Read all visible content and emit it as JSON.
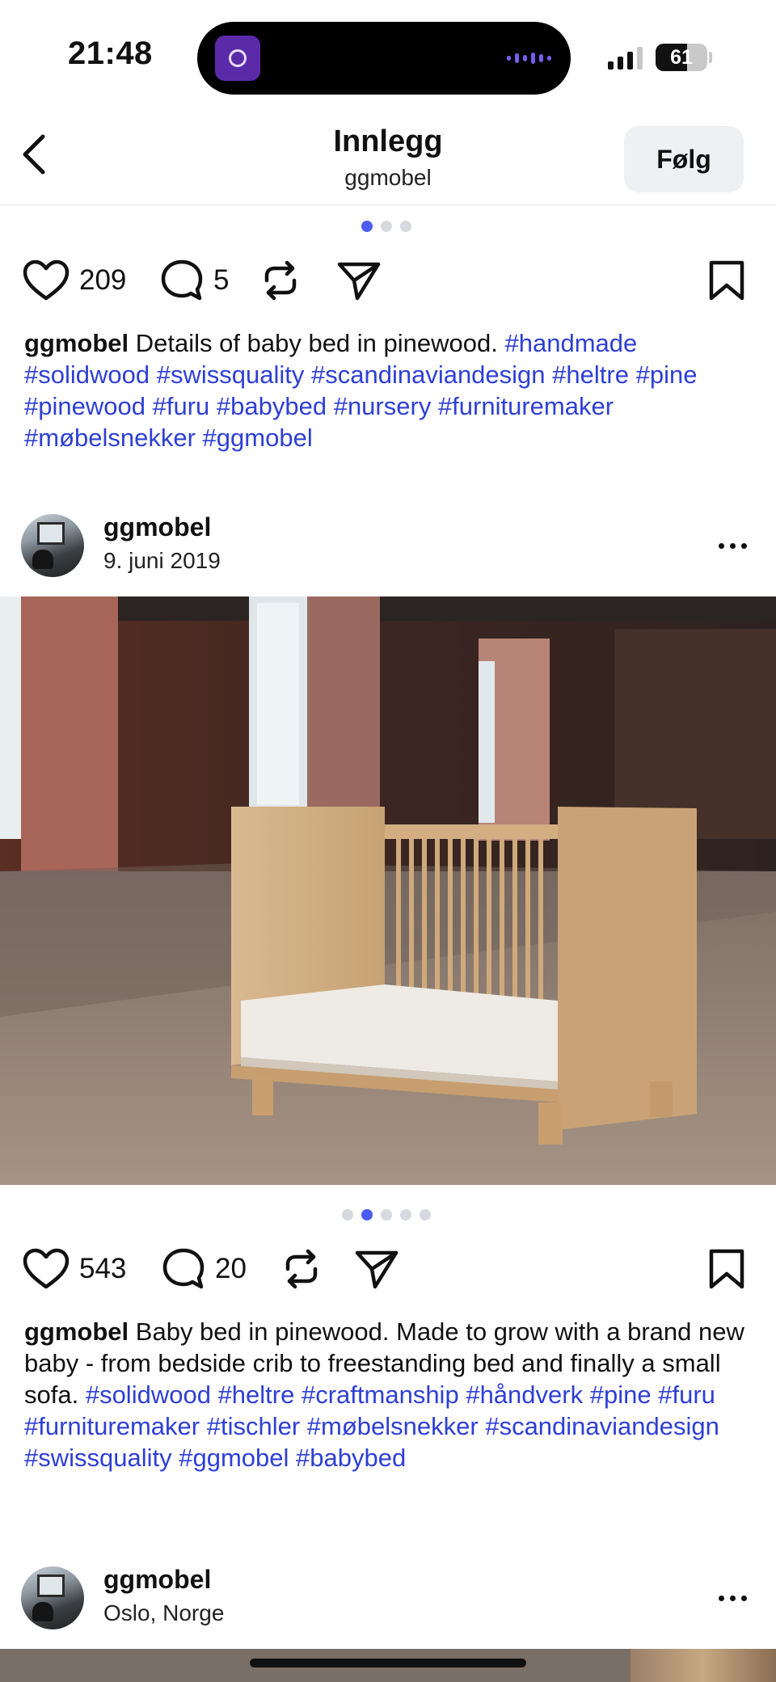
{
  "status_bar": {
    "time": "21:48",
    "battery_percent": "61",
    "battery_level": 0.61,
    "signal_bars_active": 3,
    "signal_bars_total": 4,
    "island_app_icon": "podcast-app-icon"
  },
  "header": {
    "back_icon": "chevron-left-icon",
    "title": "Innlegg",
    "subtitle": "ggmobel",
    "follow_label": "Følg"
  },
  "posts": [
    {
      "carousel": {
        "count": 3,
        "active_index": 0
      },
      "likes": "209",
      "comments": "5",
      "caption_user": "ggmobel",
      "caption_text": " Details of baby bed in pinewood. ",
      "tags": [
        "#handmade",
        "#solidwood",
        "#swissquality",
        "#scandinaviandesign",
        "#heltre",
        "#pine",
        "#pinewood",
        "#furu",
        "#babybed",
        "#nursery",
        "#furnituremaker",
        "#møbelsnekker",
        "#ggmobel"
      ]
    },
    {
      "username": "ggmobel",
      "date": "9. juni 2019",
      "carousel": {
        "count": 5,
        "active_index": 1
      },
      "likes": "543",
      "comments": "20",
      "caption_user": "ggmobel",
      "caption_text": " Baby bed in pinewood. Made to grow with a brand new baby - from bedside crib to freestanding bed and finally a small sofa. ",
      "tags": [
        "#solidwood",
        "#heltre",
        "#craftmanship",
        "#håndverk",
        "#pine",
        "#furu",
        "#furnituremaker",
        "#tischler",
        "#møbelsnekker",
        "#scandinaviandesign",
        "#swissquality",
        "#ggmobel",
        "#babybed"
      ]
    },
    {
      "username": "ggmobel",
      "location": "Oslo, Norge"
    }
  ],
  "icons": {
    "like": "heart-icon",
    "comment": "comment-bubble-icon",
    "repost": "repost-icon",
    "share": "send-icon",
    "save": "bookmark-icon",
    "more": "more-dots-icon"
  },
  "colors": {
    "hashtag": "#2e3fd6",
    "dot_active": "#4b5cf0",
    "dot_inactive": "#d7d9de",
    "follow_bg": "#eff0f3"
  }
}
